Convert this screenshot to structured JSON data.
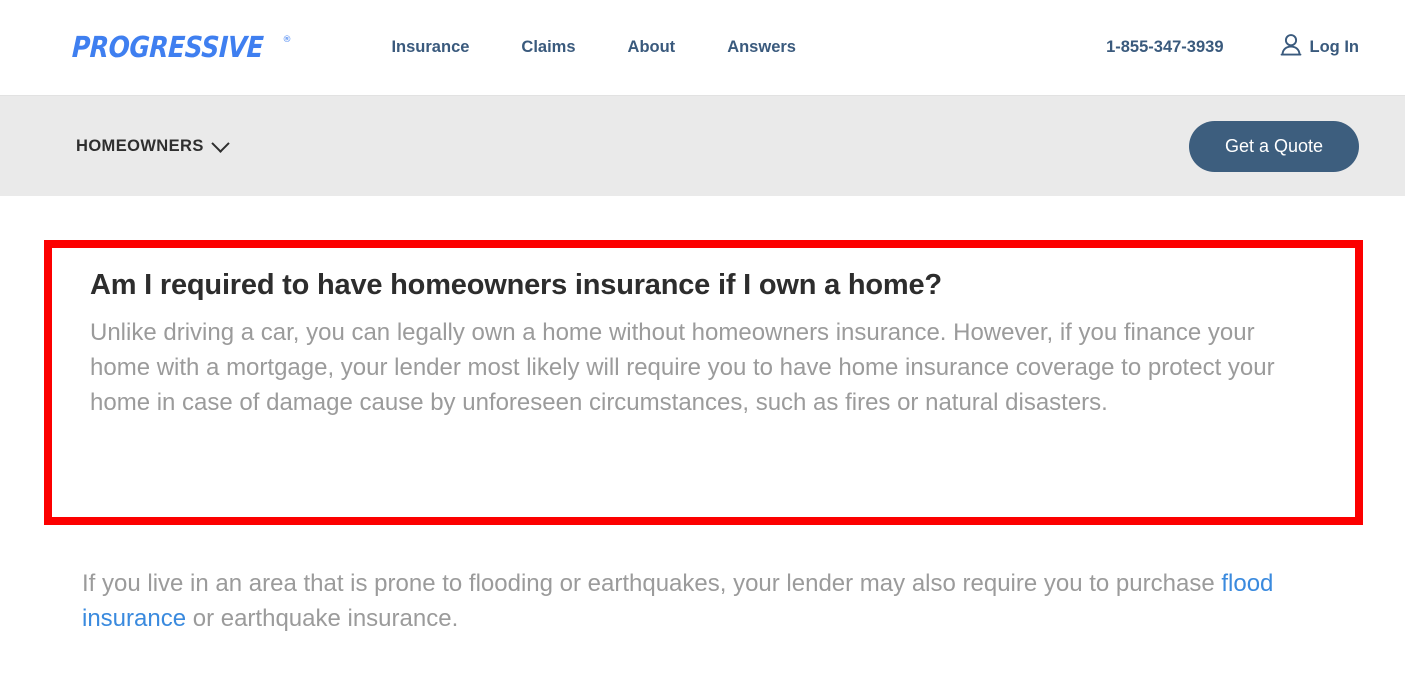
{
  "header": {
    "logo": {
      "text": "PROGRESSIVE",
      "registered_mark": "®",
      "color": "#3f7ff0"
    },
    "nav": [
      {
        "label": "Insurance",
        "name": "nav-link-insurance"
      },
      {
        "label": "Claims",
        "name": "nav-link-claims"
      },
      {
        "label": "About",
        "name": "nav-link-about"
      },
      {
        "label": "Answers",
        "name": "nav-link-answers"
      }
    ],
    "phone": "1-855-347-3939",
    "login_label": "Log In",
    "login_icon": "user-icon",
    "nav_color": "#3a5a7d"
  },
  "subnav": {
    "category_label": "HOMEOWNERS",
    "chevron_icon": "chevron-down-icon",
    "quote_button_label": "Get a Quote",
    "quote_button_color": "#3d5e7e",
    "background_color": "#eaeaea"
  },
  "content": {
    "highlight": {
      "border_color": "#fc0000",
      "question": "Am I required to have homeowners insurance if I own a home?",
      "answer": "Unlike driving a car, you can legally own a home without homeowners insurance. However, if you finance your home with a mortgage, your lender most likely will require you to have home insurance coverage to protect your home in case of damage cause by unforeseen circumstances, such as fires or natural disasters."
    },
    "paragraph_2": {
      "before_link": "If you live in an area that is prone to flooding or earthquakes, your lender may also require you to purchase ",
      "link_text": "flood insurance",
      "link_color": "#3a8ade",
      "after_link": " or earthquake insurance."
    },
    "body_text_color": "#9b9b9b"
  }
}
